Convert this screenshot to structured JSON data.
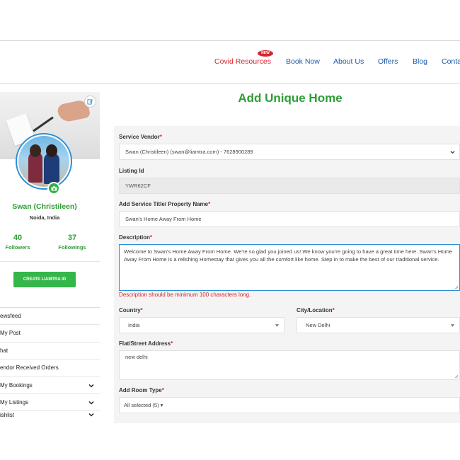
{
  "nav": {
    "items": [
      "Covid Resources",
      "Book Now",
      "About Us",
      "Offers",
      "Blog",
      "Conta"
    ],
    "new_badge": "NEW",
    "accent_red": "#d7262f",
    "link_blue": "#1e5aa8"
  },
  "profile": {
    "name": "Swan (Christileen)",
    "location": "Noida, India",
    "followers_count": "40",
    "followers_label": "Followers",
    "followings_count": "37",
    "followings_label": "Followings",
    "create_button": "CREATE LIAMTRA ID",
    "brand_green": "#2d9d35",
    "icons": {
      "edit": "edit-icon",
      "camera": "camera-icon"
    }
  },
  "sidebar": {
    "items": [
      {
        "label": "ewsfeed",
        "chevron": false
      },
      {
        "label": "My Post",
        "chevron": false
      },
      {
        "label": "hat",
        "chevron": false
      },
      {
        "label": "endor Received Orders",
        "chevron": false
      },
      {
        "label": "My Bookings",
        "chevron": true
      },
      {
        "label": "My Listings",
        "chevron": true
      },
      {
        "label": "ishlist",
        "chevron": true
      }
    ]
  },
  "form": {
    "page_title": "Add Unique Home",
    "service_vendor": {
      "label": "Service Vendor",
      "value": "Swan (Christileen) (swan@liamtra.com) - 7628900289"
    },
    "listing_id": {
      "label": "Listing Id",
      "value": "YWR62CF"
    },
    "title": {
      "label": "Add Service Title/ Property Name",
      "value": "Swan's Home Away From Home"
    },
    "description": {
      "label": "Description",
      "value": "Welcome to Swan's Home Away From Home. We're so glad you joined us! We know you're going to have a great time here. Swan's Home Away From Home is a relishing Homestay that gives you all the comfort like home. Step in to make the best of our traditional service.",
      "error": "Description should be minimum 100 characters long."
    },
    "country": {
      "label": "Country",
      "value": "India"
    },
    "city": {
      "label": "City/Location",
      "value": "New Delhi"
    },
    "address": {
      "label": "Flat/Street Address",
      "value": "new delhi"
    },
    "room_type": {
      "label": "Add Room Type",
      "value": "All selected (5) ▾"
    },
    "required_mark": "*"
  }
}
